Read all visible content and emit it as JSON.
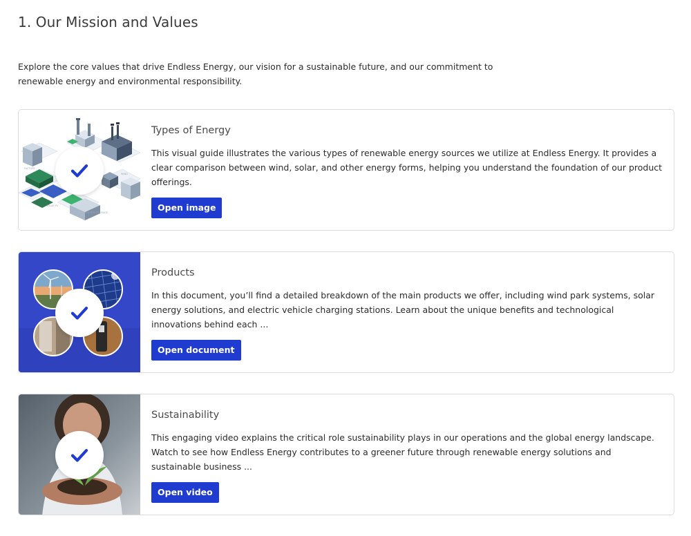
{
  "page": {
    "title": "1. Our Mission and Values",
    "intro": "Explore the core values that drive Endless Energy, our vision for a sustainable future, and our commitment to renewable energy and environmental responsibility."
  },
  "cards": [
    {
      "title": "Types of Energy",
      "description": "This visual guide illustrates the various types of renewable energy sources we utilize at Endless Energy. It provides a clear comparison between wind, solar, and other energy forms, helping you understand the foundation of our product offerings.",
      "button_label": "Open image",
      "thumbnail": "energy-types-illustration"
    },
    {
      "title": "Products",
      "description": "In this document, you’ll find a detailed breakdown of the main products we offer, including wind park systems, solar energy solutions, and electric vehicle charging stations. Learn about the unique benefits and technological innovations behind each ...",
      "button_label": "Open document",
      "thumbnail": "products-collage"
    },
    {
      "title": "Sustainability",
      "description": "This engaging video explains the critical role sustainability plays in our operations and the global energy landscape. Watch to see how Endless Energy contributes to a greener future through renewable energy solutions and sustainable business ...",
      "button_label": "Open video",
      "thumbnail": "hands-holding-plant-photo"
    }
  ],
  "colors": {
    "primary_button": "#1f3bd0",
    "check_mark": "#1f3bd0",
    "products_background": "#3447c9"
  },
  "icons": {
    "completed": "check-icon"
  }
}
